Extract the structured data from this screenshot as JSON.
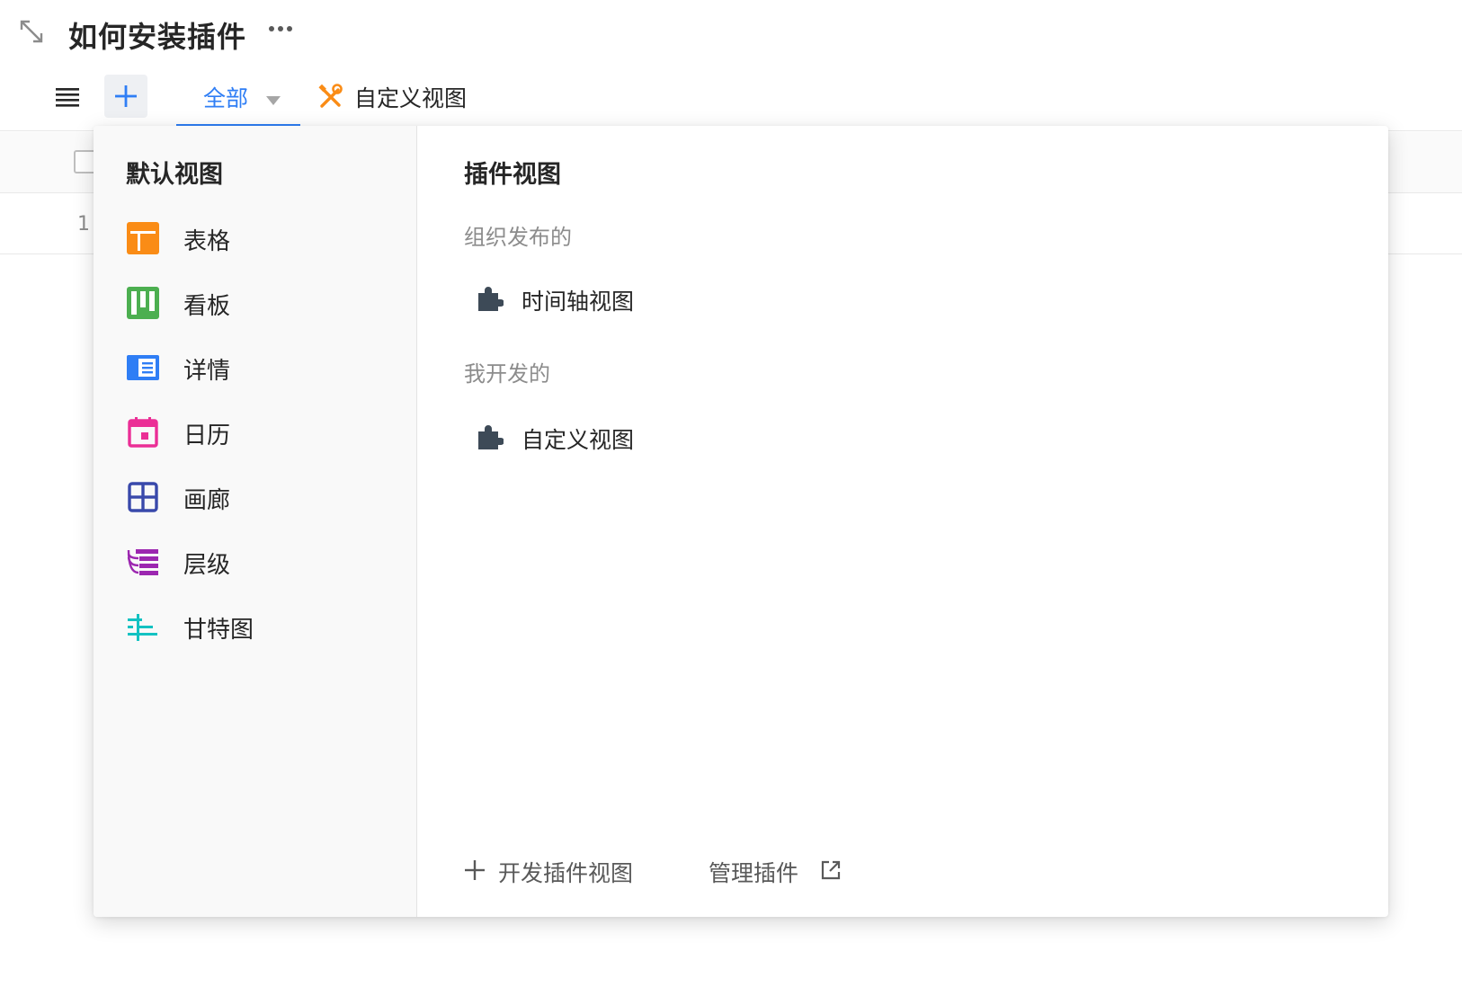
{
  "header": {
    "title": "如何安装插件"
  },
  "toolbar": {
    "tabs": [
      {
        "label": "全部",
        "active": true
      },
      {
        "label": "自定义视图",
        "icon": "tools-icon"
      }
    ]
  },
  "background_table": {
    "row_number": "1"
  },
  "popover": {
    "default_views": {
      "title": "默认视图",
      "items": [
        {
          "label": "表格",
          "icon": "table-icon",
          "color": "#fa8c16"
        },
        {
          "label": "看板",
          "icon": "kanban-icon",
          "color": "#4caf50"
        },
        {
          "label": "详情",
          "icon": "detail-icon",
          "color": "#2f7ef5"
        },
        {
          "label": "日历",
          "icon": "calendar-icon",
          "color": "#eb2f96"
        },
        {
          "label": "画廊",
          "icon": "gallery-icon",
          "color": "#3949ab"
        },
        {
          "label": "层级",
          "icon": "hierarchy-icon",
          "color": "#9c27b0"
        },
        {
          "label": "甘特图",
          "icon": "gantt-icon",
          "color": "#13c2c2"
        }
      ]
    },
    "plugin_views": {
      "title": "插件视图",
      "groups": [
        {
          "title": "组织发布的",
          "items": [
            {
              "label": "时间轴视图",
              "icon": "puzzle-icon"
            }
          ]
        },
        {
          "title": "我开发的",
          "items": [
            {
              "label": "自定义视图",
              "icon": "puzzle-icon"
            }
          ]
        }
      ],
      "footer": {
        "develop_label": "开发插件视图",
        "manage_label": "管理插件"
      }
    }
  },
  "colors": {
    "accent": "#2f7ef5",
    "tools_icon": "#fa8c16",
    "puzzle_icon": "#3d4a57"
  }
}
